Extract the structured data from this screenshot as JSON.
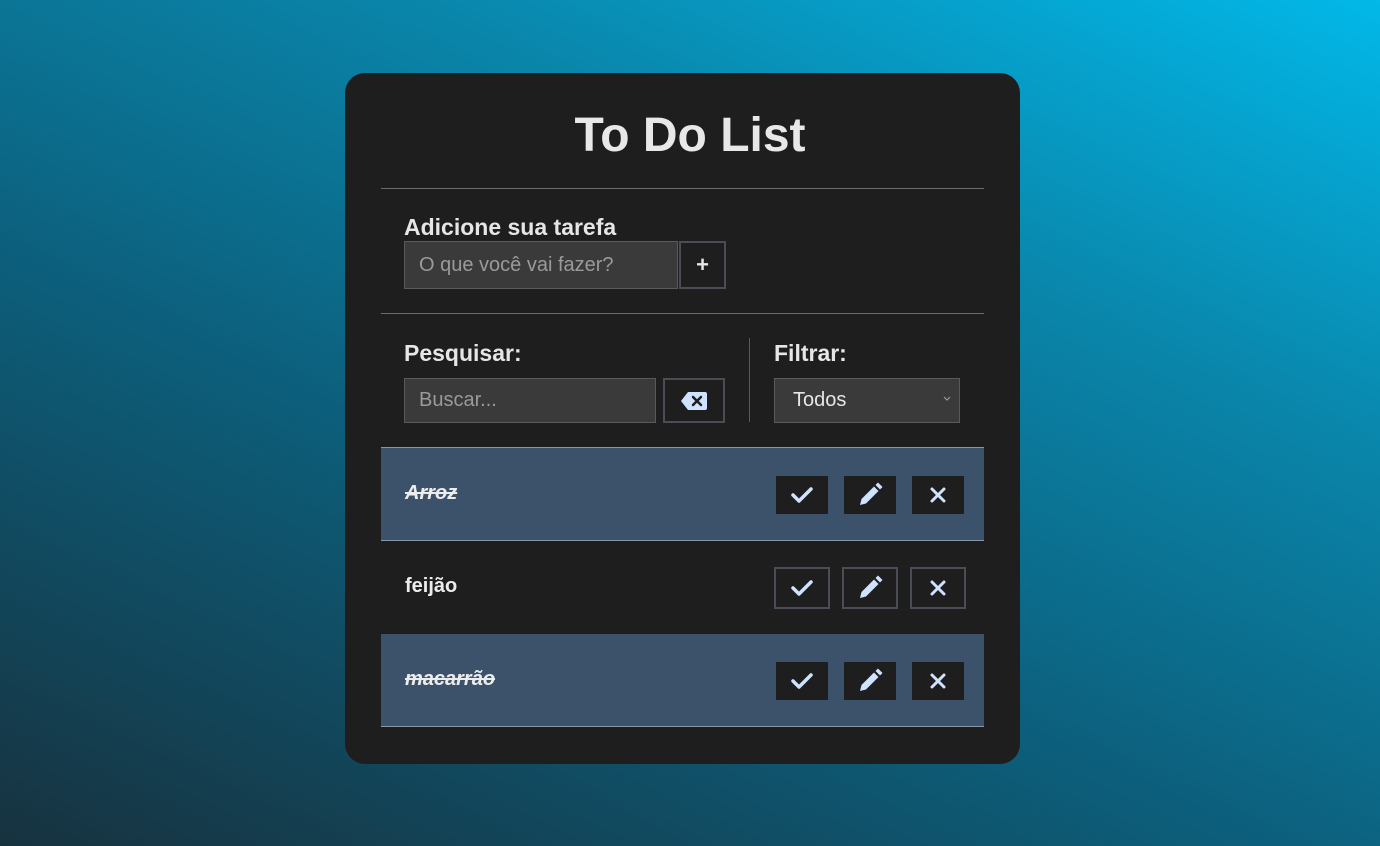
{
  "app": {
    "title": "To Do List"
  },
  "add": {
    "label": "Adicione sua tarefa",
    "placeholder": "O que você vai fazer?",
    "button": "+"
  },
  "search": {
    "label": "Pesquisar:",
    "placeholder": "Buscar..."
  },
  "filter": {
    "label": "Filtrar:",
    "selected": "Todos"
  },
  "tasks": [
    {
      "text": "Arroz",
      "done": true
    },
    {
      "text": "feijão",
      "done": false
    },
    {
      "text": "macarrão",
      "done": true
    }
  ],
  "colors": {
    "card": "#1e1e1e",
    "done_row": "#3c526b",
    "icon": "#cfe2ff"
  },
  "icons": {
    "complete": "check-icon",
    "edit": "pencil-icon",
    "remove": "x-icon",
    "clear": "backspace-icon"
  }
}
